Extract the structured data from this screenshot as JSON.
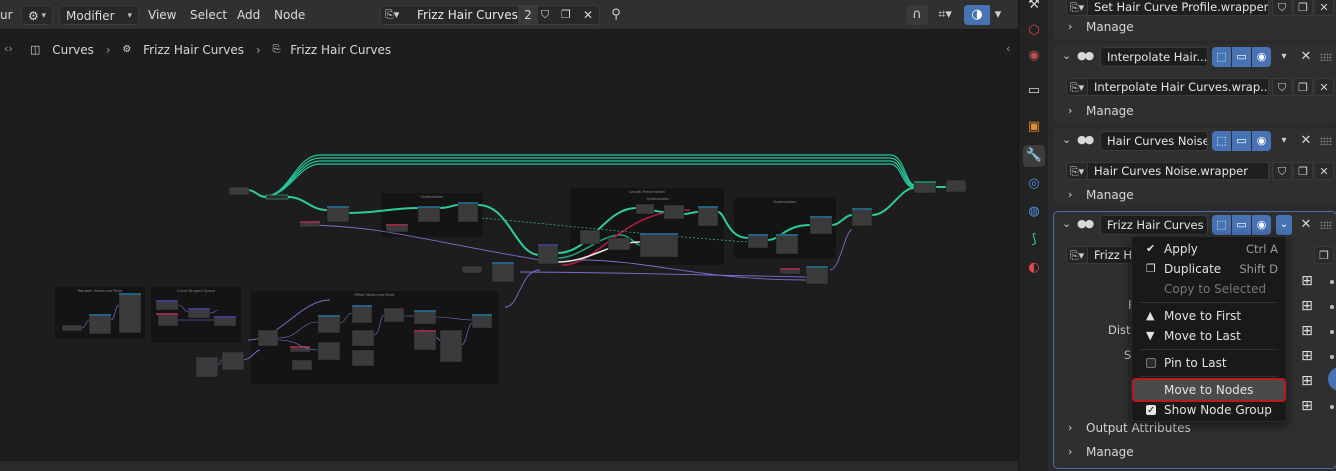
{
  "header": {
    "editor_type_clip": "ur",
    "mode": "Modifier",
    "menus": [
      "View",
      "Select",
      "Add",
      "Node"
    ],
    "node_group_name": "Frizz Hair Curves",
    "user_count": "2"
  },
  "breadcrumb": {
    "items": [
      "Curves",
      "Frizz Hair Curves",
      "Frizz Hair Curves"
    ]
  },
  "frames": [
    "Random Vector per Point",
    "Curve Tangent Space",
    "Offset Vector per Point",
    "Optimization",
    "Length Preservation",
    "Optimization",
    "Optimization"
  ],
  "modifiers": [
    {
      "name": "Set Hair Curve Profile.wrapper",
      "manage_label": "Manage"
    },
    {
      "name": "Interpolate Hair...",
      "node_group": "Interpolate Hair Curves.wrap...",
      "manage_label": "Manage"
    },
    {
      "name": "Hair Curves Noise",
      "node_group": "Hair Curves Noise.wrapper",
      "manage_label": "Manage"
    },
    {
      "name": "Frizz Hair Curves",
      "node_group_clip": "Frizz H",
      "input_labels": [
        "Fa",
        "Dist",
        "Sl"
      ],
      "output_attributes_label": "Output Attributes",
      "manage_label": "Manage"
    }
  ],
  "context_menu": {
    "items": [
      {
        "label": "Apply",
        "shortcut": "Ctrl A",
        "icon": "check-icon"
      },
      {
        "label": "Duplicate",
        "shortcut": "Shift D",
        "icon": "duplicate-icon"
      },
      {
        "label": "Copy to Selected",
        "shortcut": "",
        "disabled": true
      },
      {
        "label": "Move to First",
        "shortcut": "",
        "icon": "triangle-up-icon"
      },
      {
        "label": "Move to Last",
        "shortcut": "",
        "icon": "triangle-down-icon"
      },
      {
        "label": "Pin to Last",
        "shortcut": "",
        "checkbox": false
      },
      {
        "label": "Move to Nodes",
        "shortcut": "",
        "highlight": true
      },
      {
        "label": "Show Node Group",
        "shortcut": "",
        "checkbox": true
      }
    ]
  },
  "colors": {
    "accent_blue": "#4772b3",
    "link_teal": "#2ecc9a",
    "link_purple": "#7a6fd0",
    "highlight_red": "#c0161d"
  }
}
